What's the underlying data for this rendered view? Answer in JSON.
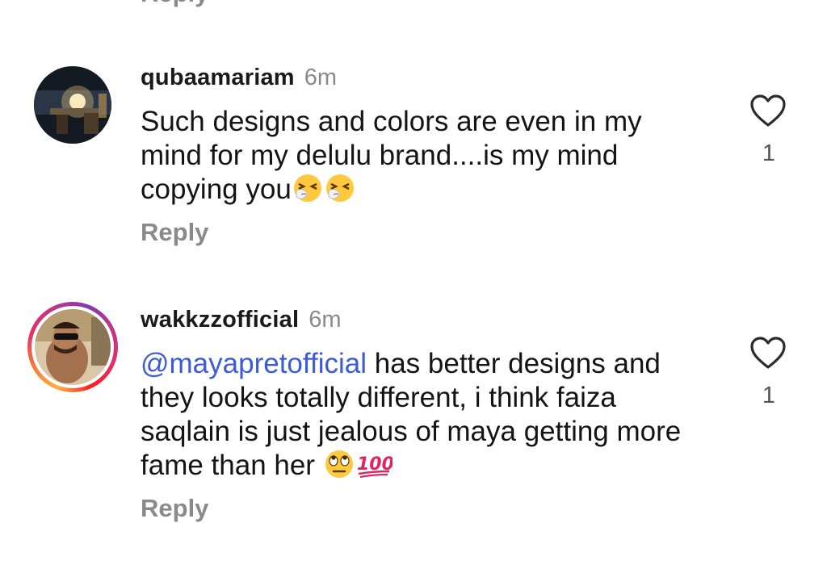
{
  "top_partial": {
    "reply_label": "Reply"
  },
  "comments": [
    {
      "username": "qubaamariam",
      "time": "6m",
      "text": "Such designs and colors are even in my mind for my delulu brand....is my mind copying you",
      "emojis": [
        "sneezing-face",
        "sneezing-face"
      ],
      "reply_label": "Reply",
      "like_count": "1",
      "has_story_ring": false
    },
    {
      "username": "wakkzzofficial",
      "time": "6m",
      "mention": "@mayapretofficial",
      "text": "has better designs and they looks totally different, i think faiza saqlain is just jealous of maya getting more fame than her",
      "emojis": [
        "face-with-rolling-eyes",
        "hundred-points"
      ],
      "reply_label": "Reply",
      "like_count": "1",
      "has_story_ring": true
    }
  ],
  "colors": {
    "mention": "#3b5bdb",
    "secondary_text": "#8a8a8a",
    "primary_text": "#141414"
  }
}
